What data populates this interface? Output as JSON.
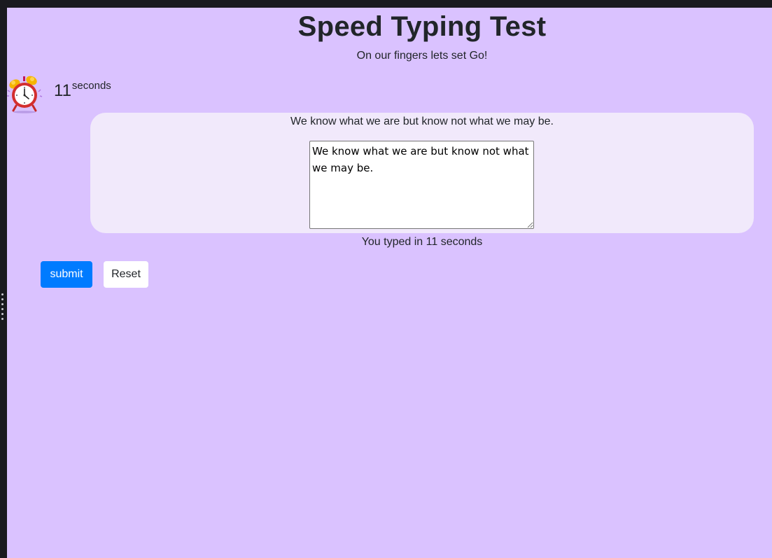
{
  "header": {
    "title": "Speed Typing Test",
    "subtitle": "On our fingers lets set Go!"
  },
  "timer": {
    "value": "11",
    "unit": "seconds",
    "icon": "alarm-clock-icon"
  },
  "quote": {
    "text": "We know what we are but know not what we may be."
  },
  "input": {
    "value": "We know what we are but know not what we may be."
  },
  "result": {
    "text": "You typed in 11 seconds"
  },
  "actions": {
    "submit_label": "submit",
    "reset_label": "Reset"
  },
  "colors": {
    "page_background": "#dac2ff",
    "card_background": "#f1e9fb",
    "primary_button": "#007bff",
    "secondary_button": "#ffffff",
    "text": "#212529"
  }
}
